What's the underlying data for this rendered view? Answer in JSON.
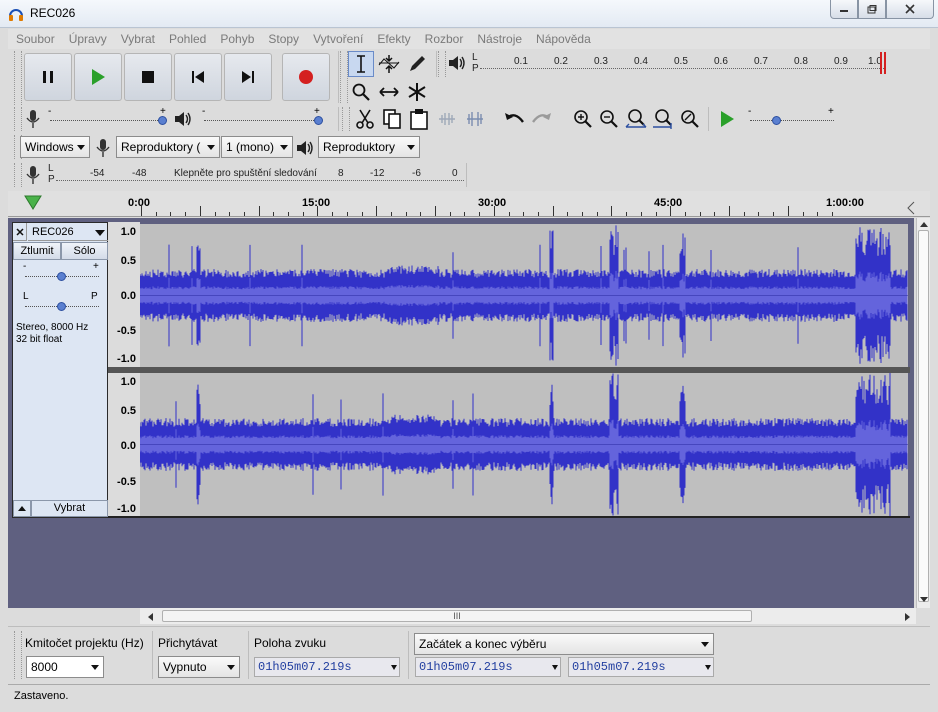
{
  "window": {
    "title": "REC026"
  },
  "menu": [
    "Soubor",
    "Úpravy",
    "Vybrat",
    "Pohled",
    "Pohyb",
    "Stopy",
    "Vytvoření",
    "Efekty",
    "Rozbor",
    "Nástroje",
    "Nápověda"
  ],
  "meter": {
    "lr_top": "L",
    "lr_bottom": "P",
    "scale": [
      "0.1",
      "0.2",
      "0.3",
      "0.4",
      "0.5",
      "0.6",
      "0.7",
      "0.8",
      "0.9",
      "1.0"
    ]
  },
  "device": {
    "host": "Windows",
    "recording_device": "Reproduktory (",
    "channels": "1 (mono)",
    "playback_device": "Reproduktory"
  },
  "rec_meter": {
    "lr_top": "L",
    "lr_bottom": "P",
    "scale_left": [
      "-54",
      "-48"
    ],
    "hint": "Klepněte pro spuštění sledování",
    "scale_right": [
      "8",
      "-12",
      "-6",
      "0"
    ]
  },
  "ruler": [
    "0:00",
    "15:00",
    "30:00",
    "45:00",
    "1:00:00"
  ],
  "track": {
    "name": "REC026",
    "mute": "Ztlumit",
    "solo": "Sólo",
    "gain_minus": "-",
    "gain_plus": "+",
    "pan_left": "L",
    "pan_right": "P",
    "info_line1": "Stereo, 8000 Hz",
    "info_line2": "32 bit float",
    "select": "Vybrat",
    "gain_value": 0.5,
    "pan_value": 0.5,
    "y_labels": [
      "1.0",
      "0.5",
      "0.0",
      "-0.5",
      "-1.0"
    ]
  },
  "hscroll_grip": "III",
  "selection_bar": {
    "rate_label": "Kmitočet projektu (Hz)",
    "rate_value": "8000",
    "snap_label": "Přichytávat",
    "snap_value": "Vypnuto",
    "pos_label": "Poloha zvuku",
    "pos_value": "01h05m07.219s",
    "range_label": "Začátek a konec výběru",
    "start_value": "01h05m07.219s",
    "end_value": "01h05m07.219s"
  },
  "status": "Zastaveno.",
  "colors": {
    "wave": "#3232c8",
    "wave_rms": "#6464dc",
    "wave_bg": "#bfbfbf",
    "track_area": "#5f6080",
    "record": "#d42020",
    "play": "#2aa02a"
  }
}
